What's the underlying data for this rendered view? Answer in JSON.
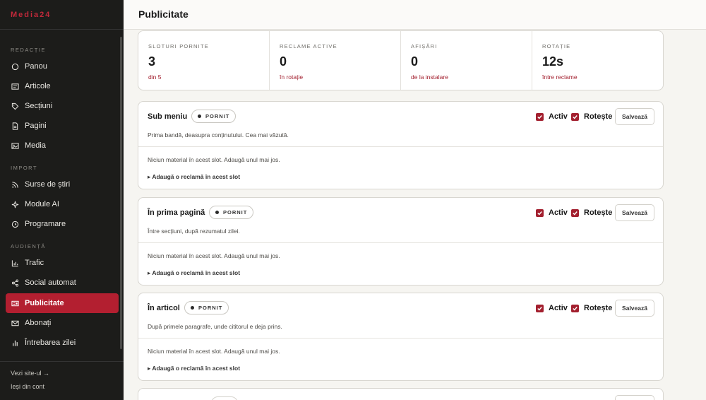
{
  "brand": "Media24",
  "sidebar": {
    "sections": [
      {
        "label": "REDACȚIE",
        "items": [
          {
            "label": "Panou",
            "icon": "dashboard-icon"
          },
          {
            "label": "Articole",
            "icon": "newspaper-icon"
          },
          {
            "label": "Secțiuni",
            "icon": "tag-icon"
          },
          {
            "label": "Pagini",
            "icon": "page-icon"
          },
          {
            "label": "Media",
            "icon": "image-icon"
          }
        ]
      },
      {
        "label": "IMPORT",
        "items": [
          {
            "label": "Surse de știri",
            "icon": "rss-icon"
          },
          {
            "label": "Module AI",
            "icon": "sparkle-icon"
          },
          {
            "label": "Programare",
            "icon": "clock-icon"
          }
        ]
      },
      {
        "label": "AUDIENȚĂ",
        "items": [
          {
            "label": "Trafic",
            "icon": "chart-icon"
          },
          {
            "label": "Social automat",
            "icon": "share-icon"
          },
          {
            "label": "Publicitate",
            "icon": "ad-icon",
            "active": true
          },
          {
            "label": "Abonați",
            "icon": "mail-icon"
          },
          {
            "label": "Întrebarea zilei",
            "icon": "poll-icon"
          }
        ]
      }
    ],
    "footer": {
      "view_site": "Vezi site-ul →",
      "logout": "Ieși din cont"
    }
  },
  "header": {
    "title": "Publicitate"
  },
  "stats": [
    {
      "label": "SLOTURI PORNITE",
      "value": "3",
      "sub": "din 5"
    },
    {
      "label": "RECLAME ACTIVE",
      "value": "0",
      "sub": "în rotație"
    },
    {
      "label": "AFIȘĂRI",
      "value": "0",
      "sub": "de la instalare"
    },
    {
      "label": "ROTAȚIE",
      "value": "12s",
      "sub": "între reclame"
    }
  ],
  "slots": [
    {
      "title": "Sub meniu",
      "badge": "PORNIT",
      "description": "Prima bandă, deasupra conținutului. Cea mai văzută.",
      "active_label": "Activ",
      "rotate_label": "Rotește",
      "save_label": "Salvează",
      "empty": "Niciun material în acest slot. Adaugă unul mai jos.",
      "add": "▸ Adaugă o reclamă în acest slot"
    },
    {
      "title": "În prima pagină",
      "badge": "PORNIT",
      "description": "Între secțiuni, după rezumatul zilei.",
      "active_label": "Activ",
      "rotate_label": "Rotește",
      "save_label": "Salvează",
      "empty": "Niciun material în acest slot. Adaugă unul mai jos.",
      "add": "▸ Adaugă o reclamă în acest slot"
    },
    {
      "title": "În articol",
      "badge": "PORNIT",
      "description": "După primele paragrafe, unde cititorul e deja prins.",
      "active_label": "Activ",
      "rotate_label": "Rotește",
      "save_label": "Salvează",
      "empty": "Niciun material în acest slot. Adaugă unul mai jos.",
      "add": "▸ Adaugă o reclamă în acest slot"
    }
  ],
  "colors": {
    "accent": "#b31f30",
    "sidebar_bg": "#1c1c1a",
    "page_bg": "#f6f5f1"
  }
}
